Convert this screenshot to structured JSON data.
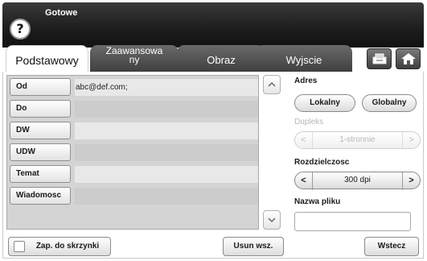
{
  "header": {
    "status": "Gotowe",
    "help_glyph": "?"
  },
  "tabs": [
    {
      "label": "Podstawowy",
      "active": true
    },
    {
      "label_line1": "Zaawansowa",
      "label_line2": "ny",
      "active": false
    },
    {
      "label": "Obraz",
      "active": false
    },
    {
      "label": "Wyjscie",
      "active": false
    }
  ],
  "toolbar_icons": [
    "tray-icon",
    "home-icon"
  ],
  "fields": [
    {
      "label": "Od",
      "value": "abc@def.com;"
    },
    {
      "label": "Do",
      "value": ""
    },
    {
      "label": "DW",
      "value": ""
    },
    {
      "label": "UDW",
      "value": ""
    },
    {
      "label": "Temat",
      "value": ""
    },
    {
      "label": "Wiadomosc",
      "value": ""
    }
  ],
  "scroll": {
    "up_glyph": "︿",
    "down_glyph": "﹀"
  },
  "right_panel": {
    "address_label": "Adres",
    "local_button": "Lokalny",
    "global_button": "Globalny",
    "duplex_label": "Dupleks",
    "duplex_value": "1-stronnie",
    "resolution_label": "Rozdzielczosc",
    "resolution_value": "300 dpi",
    "filename_label": "Nazwa pliku",
    "arrow_left": "<",
    "arrow_right": ">"
  },
  "bottom": {
    "save_to_box": "Zap. do skrzynki",
    "clear_all": "Usun wsz.",
    "back": "Wstecz"
  },
  "colors": {
    "header_bg": "#1c1c1c",
    "tab_inactive_bg": "#4a4a4a",
    "field_list_bg": "#d4d4d4"
  }
}
